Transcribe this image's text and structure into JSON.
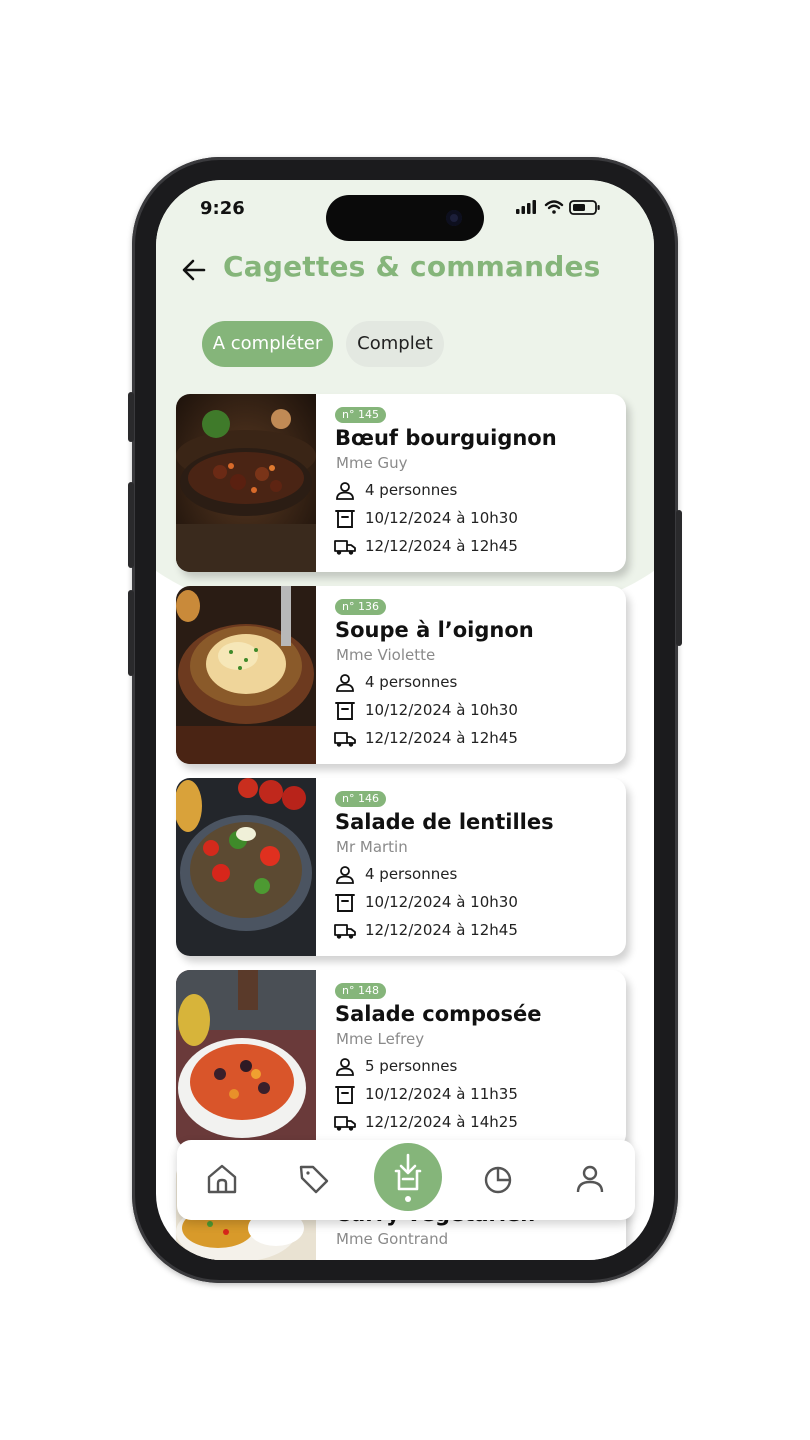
{
  "status_bar": {
    "time": "9:26"
  },
  "header": {
    "title": "Cagettes  & commandes"
  },
  "tabs": [
    {
      "label": "A compléter",
      "active": true
    },
    {
      "label": "Complet",
      "active": false
    }
  ],
  "orders": [
    {
      "badge": "n° 145",
      "dish": "Bœuf bourguignon",
      "client": "Mme Guy",
      "people": "4 personnes",
      "prep": "10/12/2024 à 10h30",
      "delivery": "12/12/2024 à 12h45",
      "image": "beef-stew-image"
    },
    {
      "badge": "n° 136",
      "dish": "Soupe à l’oignon",
      "client": "Mme Violette",
      "people": "4 personnes",
      "prep": "10/12/2024 à 10h30",
      "delivery": "12/12/2024 à 12h45",
      "image": "onion-soup-image"
    },
    {
      "badge": "n° 146",
      "dish": "Salade de lentilles",
      "client": "Mr Martin",
      "people": "4 personnes",
      "prep": "10/12/2024 à 10h30",
      "delivery": "12/12/2024 à 12h45",
      "image": "lentil-salad-image"
    },
    {
      "badge": "n° 148",
      "dish": "Salade composée",
      "client": "Mme Lefrey",
      "people": "5 personnes",
      "prep": "10/12/2024 à 11h35",
      "delivery": "12/12/2024 à 14h25",
      "image": "mixed-salad-image"
    },
    {
      "badge": "",
      "dish": "Curry végétarien",
      "client": "Mme Gontrand",
      "people": "",
      "prep": "",
      "delivery": "",
      "image": "curry-image"
    }
  ],
  "nav": [
    "home-icon",
    "tag-icon",
    "crate-download-icon",
    "pie-chart-icon",
    "user-icon"
  ],
  "colors": {
    "accent": "#85b57a",
    "header_bg": "#edf3ea",
    "inactive_tab": "#e3e8e1"
  }
}
